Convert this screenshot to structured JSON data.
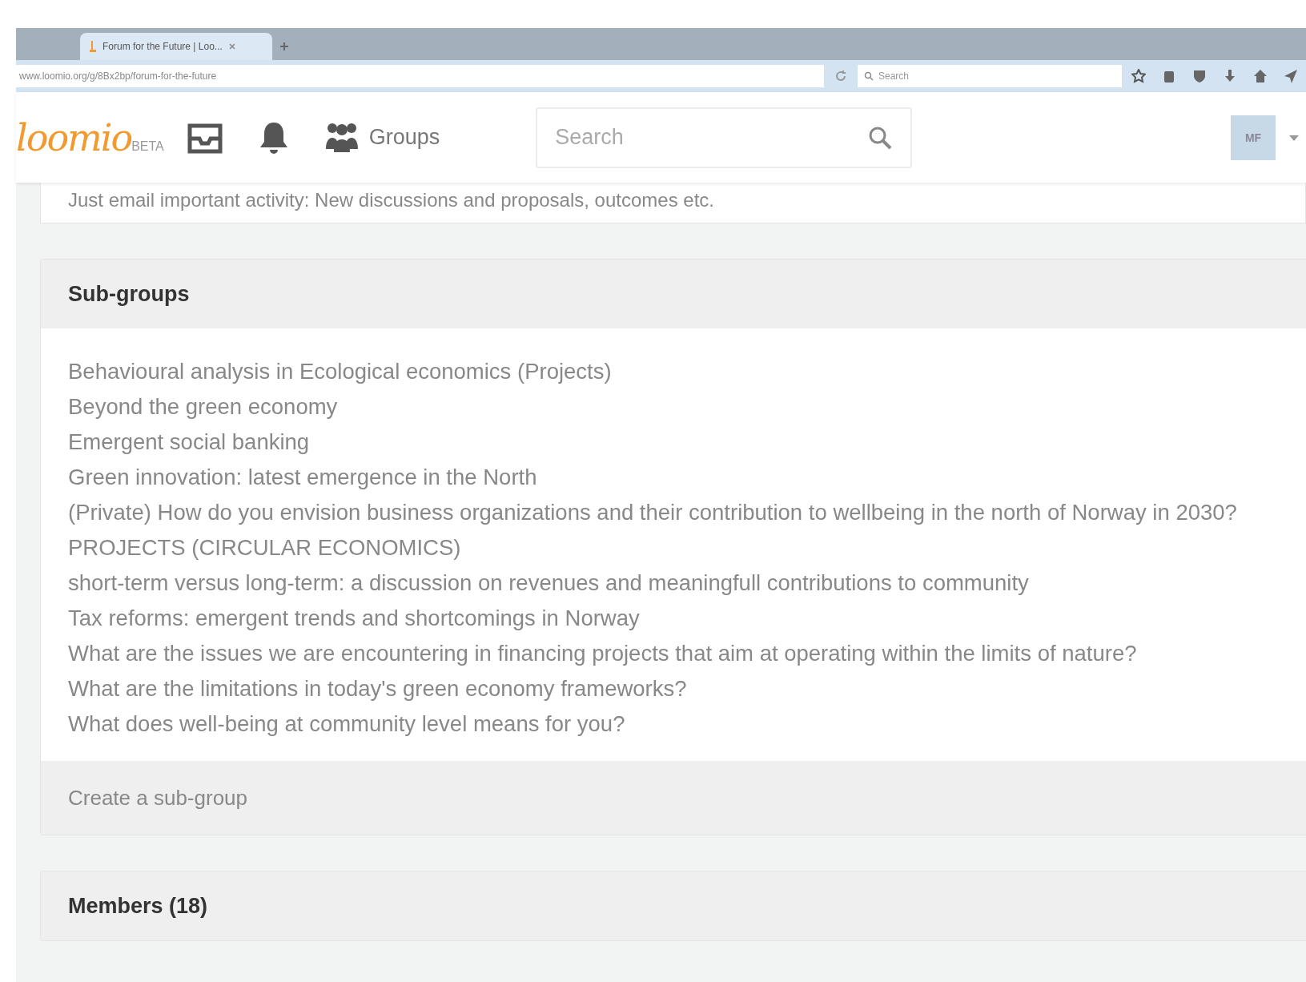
{
  "browser": {
    "tabs": [
      {
        "title": "Forum for the Future | Loo...",
        "selected": true
      }
    ],
    "address": "www.loomio.org/g/8Bx2bp/forum-for-the-future",
    "search_placeholder": "Search"
  },
  "header": {
    "logo": "loomio",
    "logo_badge": "BETA",
    "groups_label": "Groups",
    "search_placeholder": "Search",
    "avatar_initials": "MF"
  },
  "email_note": "Just email important activity: New discussions and proposals, outcomes etc.",
  "subgroups": {
    "title": "Sub-groups",
    "items": [
      "Behavioural analysis in Ecological economics (Projects)",
      "Beyond the green economy",
      "Emergent social banking",
      "Green innovation: latest emergence in the North",
      "(Private) How do you envision business organizations and their contribution to wellbeing in the north of Norway in 2030?",
      "PROJECTS (CIRCULAR ECONOMICS)",
      "short-term versus long-term: a discussion on revenues and meaningfull contributions to community",
      "Tax reforms: emergent trends and shortcomings in Norway",
      "What are the issues we are encountering in financing projects that aim at operating within the limits of nature?",
      "What are the limitations in today's green economy frameworks?",
      "What does well-being at community level means for you?"
    ],
    "create_link": "Create a sub-group"
  },
  "members": {
    "title": "Members (18)"
  }
}
